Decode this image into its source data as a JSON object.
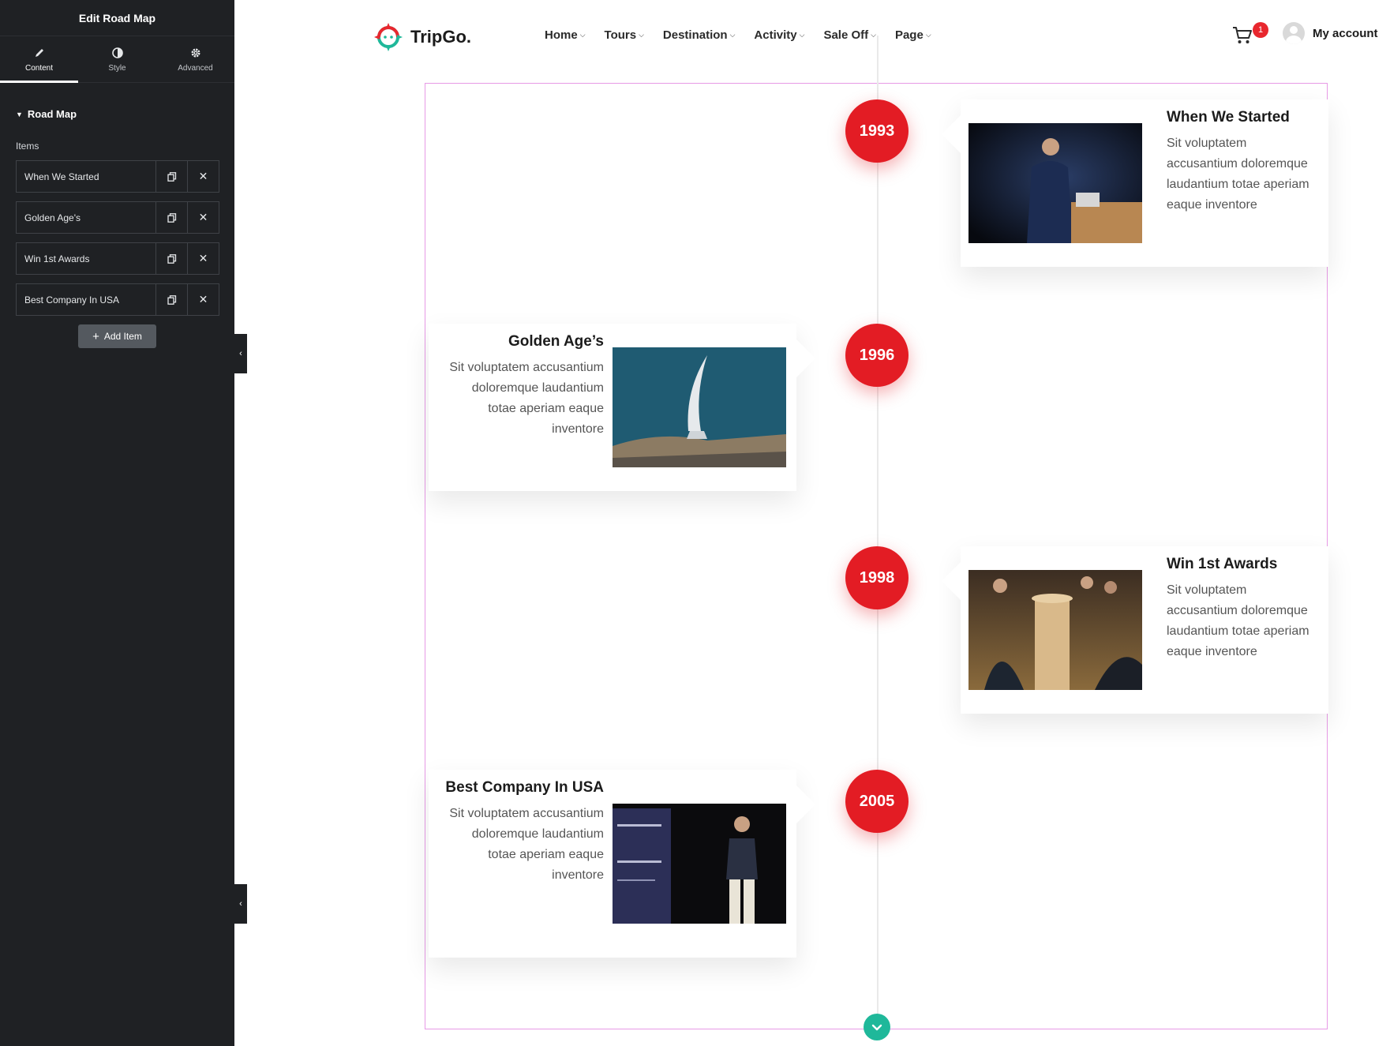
{
  "editor": {
    "title": "Edit Road Map",
    "tabs": [
      {
        "label": "Content",
        "icon": "pencil-icon"
      },
      {
        "label": "Style",
        "icon": "contrast-icon"
      },
      {
        "label": "Advanced",
        "icon": "gear-icon"
      }
    ],
    "section_title": "Road Map",
    "items_label": "Items",
    "items": [
      {
        "title": "When We Started"
      },
      {
        "title": "Golden Age's"
      },
      {
        "title": "Win 1st Awards"
      },
      {
        "title": "Best Company In USA"
      }
    ],
    "add_item_label": "Add Item"
  },
  "site": {
    "brand": "TripGo.",
    "nav": [
      "Home",
      "Tours",
      "Destination",
      "Activity",
      "Sale Off",
      "Page"
    ],
    "cart_count": "1",
    "account_label": "My account"
  },
  "roadmap": [
    {
      "year": "1993",
      "title": "When We Started",
      "body": "Sit voluptatem accusantium doloremque laudantium totae aperiam eaque inventore"
    },
    {
      "year": "1996",
      "title": "Golden Age’s",
      "body": "Sit voluptatem accusantium doloremque laudantium totae aperiam eaque inventore"
    },
    {
      "year": "1998",
      "title": "Win 1st Awards",
      "body": "Sit voluptatem accusantium doloremque laudantium totae aperiam eaque inventore"
    },
    {
      "year": "2005",
      "title": "Best Company In USA",
      "body": "Sit voluptatem accusantium doloremque laudantium totae aperiam eaque inventore"
    }
  ],
  "colors": {
    "accent_red": "#e31c24",
    "accent_green": "#1fb89a",
    "panel_bg": "#1f2124",
    "frame_border": "#e79ae6"
  }
}
